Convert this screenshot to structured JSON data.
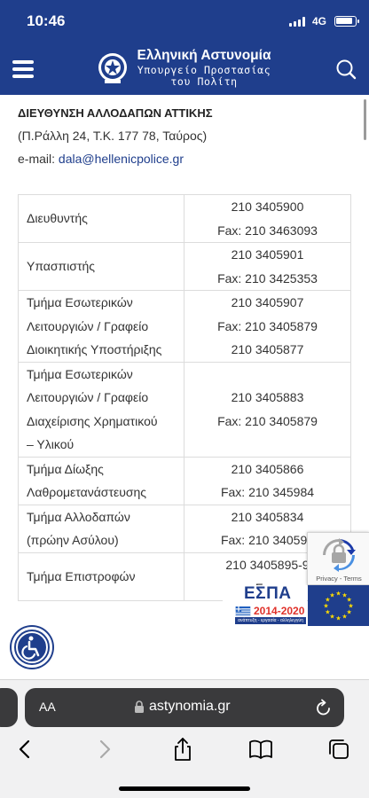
{
  "status_bar": {
    "time": "10:46",
    "network": "4G"
  },
  "header": {
    "title": "Ελληνική Αστυνομία",
    "subtitle_line1": "Υπουργείο Προστασίας",
    "subtitle_line2": "του Πολίτη"
  },
  "department": {
    "title": "ΔΙΕΥΘΥΝΣΗ ΑΛΛΟΔΑΠΩΝ ΑΤΤΙΚΗΣ",
    "address": "(Π.Ράλλη 24, Τ.Κ. 177 78, Ταύρος)",
    "email_label": "e-mail: ",
    "email": "dala@hellenicpolice.gr"
  },
  "contacts": [
    {
      "name": [
        "Διευθυντής"
      ],
      "phones": [
        "210 3405900",
        "Fax: 210 3463093"
      ]
    },
    {
      "name": [
        "Υπασπιστής"
      ],
      "phones": [
        "210 3405901",
        "Fax: 210 3425353"
      ]
    },
    {
      "name": [
        "Τμήμα Εσωτερικών",
        "Λειτουργιών / Γραφείο",
        "Διοικητικής Υποστήριξης"
      ],
      "phones": [
        "210 3405907",
        "Fax: 210 3405879",
        "210 3405877"
      ]
    },
    {
      "name": [
        "Τμήμα Εσωτερικών",
        "Λειτουργιών / Γραφείο",
        "Διαχείρισης Χρηματικού",
        "– Υλικού"
      ],
      "phones": [
        "210 3405883",
        "Fax: 210 3405879"
      ]
    },
    {
      "name": [
        "Τμήμα Δίωξης",
        "Λαθρομετανάστευσης"
      ],
      "phones": [
        "210 3405866",
        "Fax: 210 345984"
      ]
    },
    {
      "name": [
        "Τμήμα Αλλοδαπών",
        "(πρώην Ασύλου)"
      ],
      "phones": [
        "210 3405834",
        "Fax: 210 340598"
      ]
    },
    {
      "name": [
        "Τμήμα Επιστροφών"
      ],
      "phones": [
        "210 3405895-9",
        "Fax:"
      ]
    }
  ],
  "recaptcha": {
    "terms": "Privacy - Terms"
  },
  "espa": {
    "word": "ΕΣΠΑ",
    "years": "2014-2020",
    "slogan": "ανάπτυξη - εργασία - αλληλεγγύη"
  },
  "browser": {
    "text_size": "AA",
    "url": "astynomia.gr"
  },
  "colors": {
    "brand_blue": "#1f3e8c",
    "espa_red": "#e0322b",
    "eu_star": "#ffdd00"
  },
  "icons": {
    "menu": "hamburger-icon",
    "logo": "police-emblem",
    "search": "search-icon",
    "accessibility": "wheelchair-icon",
    "lock": "lock-icon",
    "reload": "reload-icon",
    "back": "chevron-left-icon",
    "forward": "chevron-right-icon",
    "share": "share-icon",
    "bookmarks": "book-icon",
    "tabs": "tabs-icon"
  }
}
